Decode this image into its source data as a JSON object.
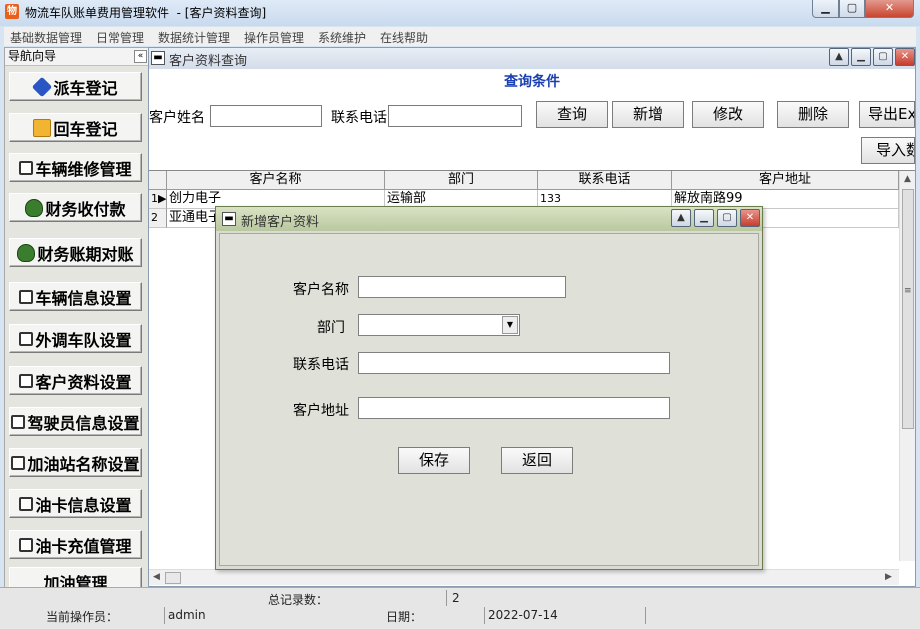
{
  "window": {
    "app_title": "物流车队账单费用管理软件",
    "doc_title": "- [客户资料查询]",
    "buttons": {
      "min": "▭",
      "max": "▢",
      "close": "X"
    }
  },
  "menu": [
    "基础数据管理",
    "日常管理",
    "数据统计管理",
    "操作员管理",
    "系统维护",
    "在线帮助"
  ],
  "nav": {
    "header": "导航向导",
    "collapse": "«",
    "items": [
      {
        "label": "派车登记",
        "icon": "truck-icon"
      },
      {
        "label": "回车登记",
        "icon": "folder-icon"
      },
      {
        "label": "车辆维修管理",
        "icon": "form-icon"
      },
      {
        "label": "财务收付款",
        "icon": "money-bag-icon"
      },
      {
        "label": "财务账期对账",
        "icon": "money-bag-icon"
      },
      {
        "label": "车辆信息设置",
        "icon": "form-icon"
      },
      {
        "label": "外调车队设置",
        "icon": "form-icon"
      },
      {
        "label": "客户资料设置",
        "icon": "form-icon"
      },
      {
        "label": "驾驶员信息设置",
        "icon": "form-icon"
      },
      {
        "label": "加油站名称设置",
        "icon": "form-icon"
      },
      {
        "label": "油卡信息设置",
        "icon": "form-icon"
      },
      {
        "label": "油卡充值管理",
        "icon": "form-icon"
      },
      {
        "label": "加油管理",
        "icon": ""
      }
    ]
  },
  "query": {
    "window_title": "客户资料查询",
    "section_title": "查询条件",
    "name_label": "客户姓名",
    "phone_label": "联系电话",
    "name_value": "",
    "phone_value": "",
    "buttons": {
      "search": "查询",
      "add": "新增",
      "edit": "修改",
      "delete": "删除",
      "export": "导出Ex",
      "import": "导入数"
    }
  },
  "grid": {
    "columns": [
      "客户名称",
      "部门",
      "联系电话",
      "客户地址"
    ],
    "rows": [
      {
        "num": "1",
        "marker": "▶",
        "name": "创力电子",
        "dept": "运输部",
        "phone": "133",
        "address": "解放南路99"
      },
      {
        "num": "2",
        "marker": "",
        "name": "亚通电子",
        "dept": "",
        "phone": "",
        "address": ""
      }
    ]
  },
  "dialog": {
    "title": "新增客户资料",
    "fields": {
      "name_label": "客户名称",
      "dept_label": "部门",
      "phone_label": "联系电话",
      "address_label": "客户地址",
      "name_value": "",
      "dept_value": "",
      "phone_value": "",
      "address_value": ""
    },
    "buttons": {
      "save": "保存",
      "back": "返回"
    }
  },
  "status": {
    "total_label": "总记录数：",
    "total_value": "2",
    "operator_label": "当前操作员：",
    "operator_value": "admin",
    "date_label": "日期：",
    "date_value": "2022-07-14"
  }
}
